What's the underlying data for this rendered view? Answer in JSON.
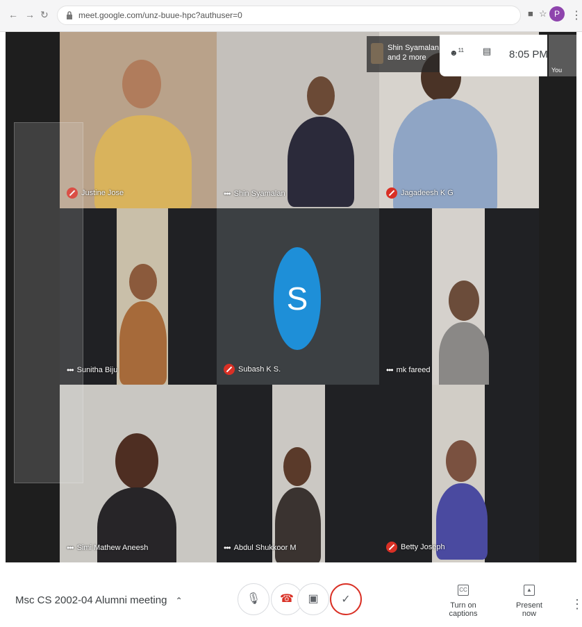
{
  "browser": {
    "url": "meet.google.com/unz-buue-hpc?authuser=0",
    "profile_initial": "P"
  },
  "header": {
    "pill_name": "Shin Syamalan",
    "pill_more": "and 2 more",
    "people_count": "11",
    "time": "8:05 PM",
    "you_label": "You"
  },
  "avatar": {
    "letter": "S",
    "color": "#1e8fd8"
  },
  "participants": [
    {
      "name": "Justine Jose",
      "mic": "off"
    },
    {
      "name": "Shin Syamalan",
      "mic": "speaking"
    },
    {
      "name": "Jagadeesh K G",
      "mic": "off"
    },
    {
      "name": "Sunitha Biju",
      "mic": "speaking"
    },
    {
      "name": "Subash K S.",
      "mic": "off"
    },
    {
      "name": "mk fareed",
      "mic": "speaking"
    },
    {
      "name": "Simi Mathew Aneesh",
      "mic": "speaking"
    },
    {
      "name": "Abdul Shukkoor M",
      "mic": "speaking"
    },
    {
      "name": "Betty Joseph",
      "mic": "off"
    }
  ],
  "bottom": {
    "meeting_name": "Msc CS 2002-04 Alumni meeting",
    "captions_label": "Turn on captions",
    "present_label": "Present now"
  },
  "colors": {
    "stage_bg": "#202124",
    "mic_off_red": "#d93025",
    "avatar_blue": "#1e8fd8"
  }
}
